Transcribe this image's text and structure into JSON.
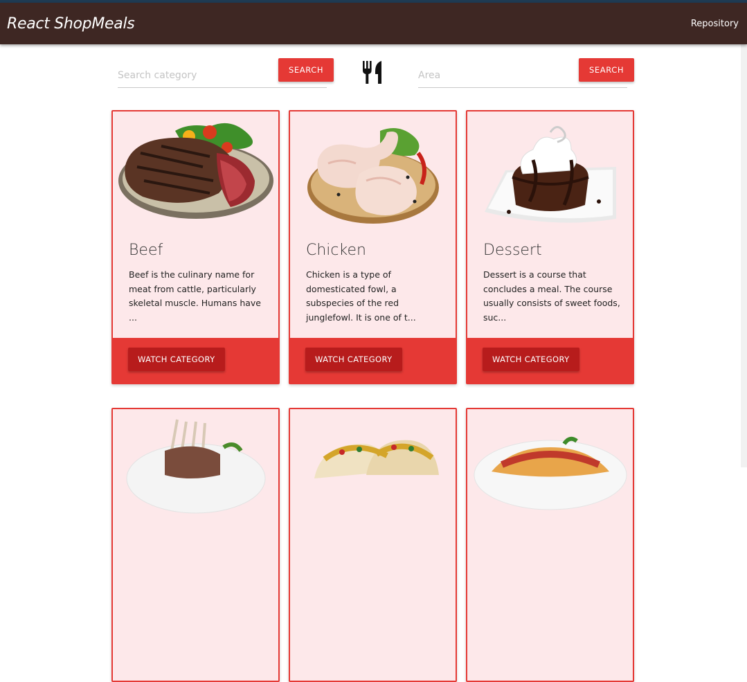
{
  "app": {
    "title": "React ShopMeals",
    "nav_link": "Repository"
  },
  "search": {
    "category_placeholder": "Search category",
    "category_button": "SEARCH",
    "area_placeholder": "Area",
    "area_button": "SEARCH",
    "divider_icon": "cutlery-icon"
  },
  "categories": [
    {
      "title": "Beef",
      "description": "Beef is the culinary name for meat from cattle, particularly skeletal muscle. Humans have ...",
      "button": "WATCH CATEGORY",
      "image": "beef-steak-image"
    },
    {
      "title": "Chicken",
      "description": "Chicken is a type of domesticated fowl, a subspecies of the red junglefowl. It is one of t...",
      "button": "WATCH CATEGORY",
      "image": "chicken-legs-image"
    },
    {
      "title": "Dessert",
      "description": "Dessert is a course that concludes a meal. The course usually consists of sweet foods, suc...",
      "button": "WATCH CATEGORY",
      "image": "chocolate-dessert-image"
    },
    {
      "image": "lamb-rack-image"
    },
    {
      "image": "tacos-image"
    },
    {
      "image": "pasta-image"
    }
  ],
  "colors": {
    "navbar": "#3e2723",
    "accent": "#e53935",
    "accent_dark": "#b71c1c",
    "card_bg": "#fde8ea"
  }
}
